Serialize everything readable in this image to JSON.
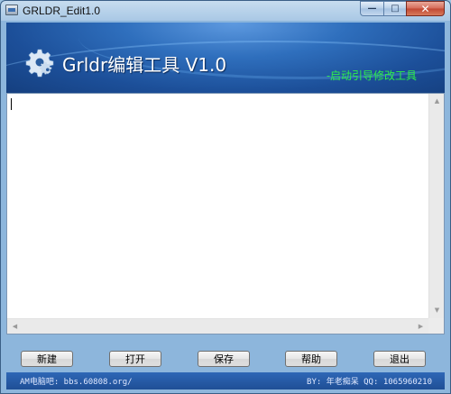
{
  "window": {
    "title": "GRLDR_Edit1.0",
    "controls": {
      "minimize": "—",
      "maximize": "□",
      "close": "✕"
    }
  },
  "banner": {
    "title": "Grldr编辑工具 V1.0",
    "subtitle": "-启动引导修改工具",
    "icon": "gear-icon"
  },
  "editor": {
    "value": ""
  },
  "buttons": {
    "new": "新建",
    "open": "打开",
    "save": "保存",
    "help": "帮助",
    "exit": "退出"
  },
  "status": {
    "left": "AM电脑吧: bbs.60808.org/",
    "right": "BY: 年老痴呆 QQ: 1065960210"
  },
  "colors": {
    "banner_subtitle": "#2ef04a",
    "status_bar": "#1f4f96"
  }
}
